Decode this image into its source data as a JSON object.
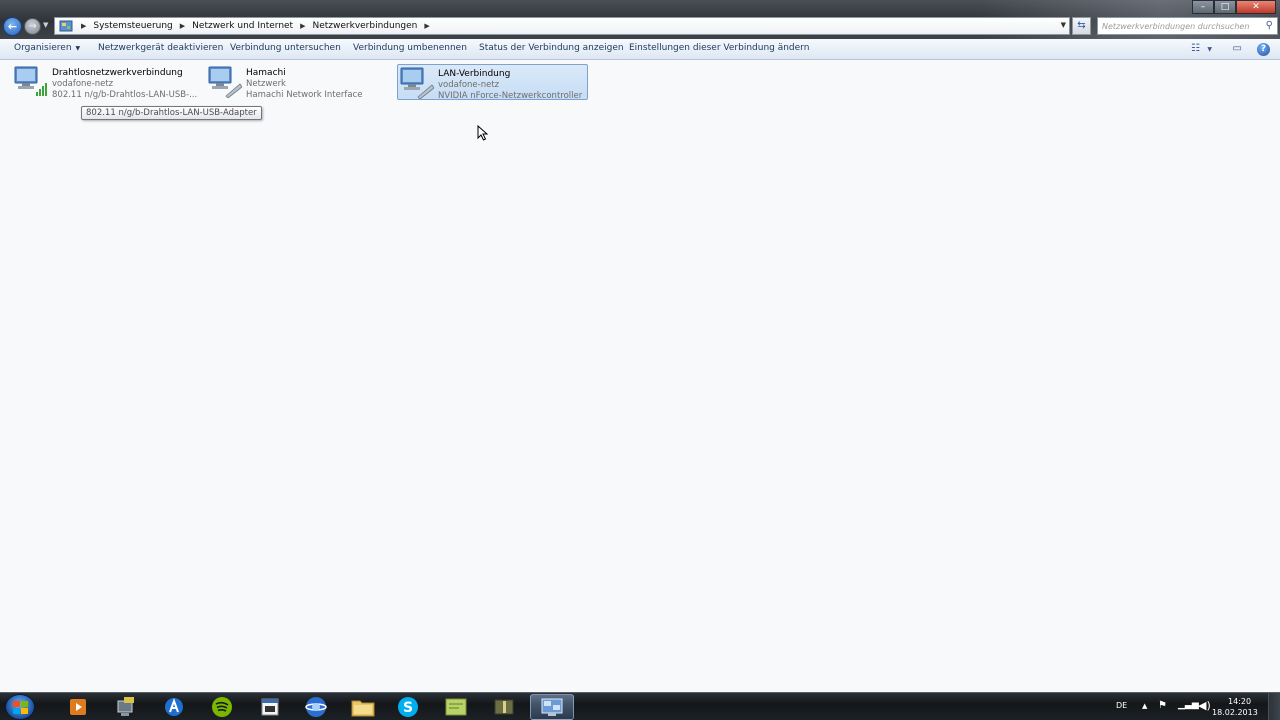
{
  "window": {
    "controls": {
      "minimize": "–",
      "maximize": "□",
      "close": "✕"
    }
  },
  "address_bar": {
    "breadcrumbs": [
      "Systemsteuerung",
      "Netzwerk und Internet",
      "Netzwerkverbindungen"
    ],
    "icon": "control-panel-icon"
  },
  "search": {
    "placeholder": "Netzwerkverbindungen durchsuchen",
    "icon": "search-icon"
  },
  "commands": {
    "organize": "Organisieren",
    "activate_device": "Netzwerkgerät deaktivieren",
    "diagnose": "Verbindung untersuchen",
    "rename": "Verbindung umbenennen",
    "status": "Status der Verbindung anzeigen",
    "change_settings": "Einstellungen dieser Verbindung ändern"
  },
  "connections": [
    {
      "name": "Drahtlosnetzwerkverbindung",
      "network": "vodafone-netz",
      "device": "802.11 n/g/b-Drahtlos-LAN-USB-...",
      "icon": "wireless-network-icon",
      "selected": false
    },
    {
      "name": "Hamachi",
      "network": "Netzwerk",
      "device": "Hamachi Network Interface",
      "icon": "network-adapter-icon",
      "selected": false
    },
    {
      "name": "LAN-Verbindung",
      "network": "vodafone-netz",
      "device": "NVIDIA nForce-Netzwerkcontroller",
      "icon": "network-adapter-icon",
      "selected": true
    }
  ],
  "tooltip": {
    "text": "802.11 n/g/b-Drahtlos-LAN-USB-Adapter"
  },
  "taskbar": {
    "apps": [
      "media-player-icon",
      "network-monitor-icon",
      "app-store-icon",
      "spotify-icon",
      "calendar-icon",
      "browser-icon",
      "file-explorer-icon",
      "skype-icon",
      "notes-icon",
      "tool-icon",
      "network-connections-icon"
    ],
    "active_app": "network-connections-icon",
    "language": "DE",
    "time": "14:20",
    "date": "18.02.2013"
  },
  "colors": {
    "accent": "#1e395b",
    "selection": "#c6ddf5",
    "taskbar": "#141719"
  }
}
